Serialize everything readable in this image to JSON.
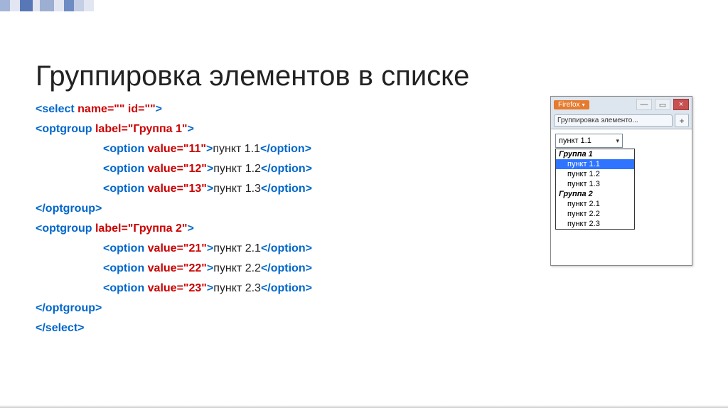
{
  "title": "Группировка элементов в списке",
  "code": {
    "l1_open": "<select ",
    "l1_attr1": "name=\"\" ",
    "l1_attr2": "id=\"\"",
    "l1_close": ">",
    "l2_open": "<optgroup ",
    "l2_attr": "label=\"Группа 1\"",
    "l2_close": ">",
    "opt_open": "<option ",
    "opt_val11": "value=\"11\"",
    "opt_val12": "value=\"12\"",
    "opt_val13": "value=\"13\"",
    "opt_val21": "value=\"21\"",
    "opt_val22": "value=\"22\"",
    "opt_val23": "value=\"23\"",
    "gt": ">",
    "txt11": "пункт 1.1",
    "txt12": "пункт 1.2",
    "txt13": "пункт 1.3",
    "txt21": "пункт 2.1",
    "txt22": "пункт 2.2",
    "txt23": "пункт 2.3",
    "opt_close": "</option>",
    "og_close": "</optgroup>",
    "l5_open": "<optgroup ",
    "l5_attr": "label=\"Группа 2\"",
    "l5_close": ">",
    "sel_close": "</select>"
  },
  "win": {
    "firefox": "Firefox",
    "min": "—",
    "max": "▭",
    "close": "×",
    "tab": "Группировка элементо...",
    "plus": "+",
    "selected": "пункт 1.1",
    "grp1": "Группа 1",
    "o11": "пункт 1.1",
    "o12": "пункт 1.2",
    "o13": "пункт 1.3",
    "grp2": "Группа 2",
    "o21": "пункт 2.1",
    "o22": "пункт 2.2",
    "o23": "пункт 2.3"
  }
}
